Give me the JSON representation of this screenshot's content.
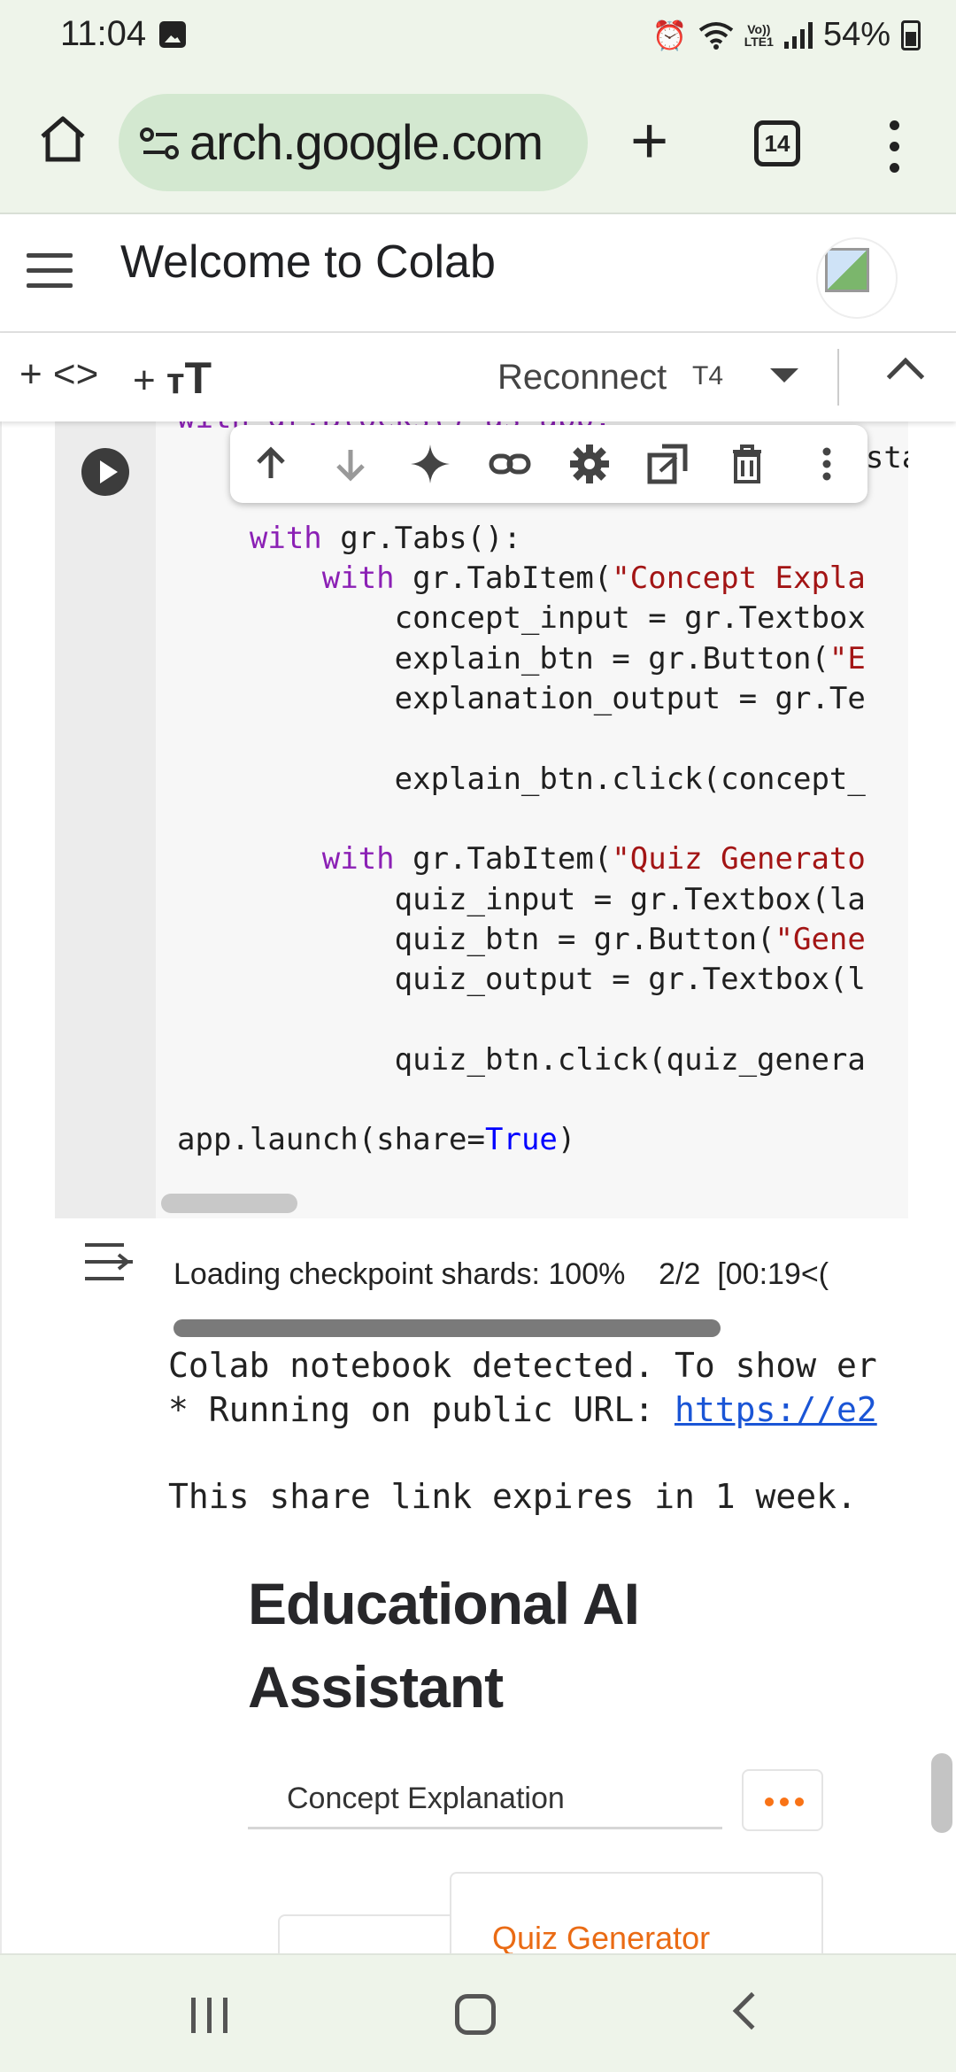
{
  "status_bar": {
    "time": "11:04",
    "battery": "54%",
    "network": "LTE1",
    "icons": [
      "photo-icon",
      "alarm-icon",
      "wifi-icon",
      "volte-icon",
      "signal-icon",
      "battery-icon"
    ]
  },
  "browser": {
    "url": "arch.google.com",
    "tab_count": "14"
  },
  "colab": {
    "title": "Welcome to Colab",
    "toolbar": {
      "add_code": "+ <>",
      "add_text": "+",
      "reconnect": "Reconnect",
      "runtime": "T4"
    }
  },
  "code_lines": [
    {
      "indent": "",
      "parts": [
        {
          "t": "with gr.Blocks() as app:",
          "c": "kw-partial"
        }
      ]
    },
    {
      "indent": "    ",
      "parts": [
        {
          "t": "gr.Markdown(\"# Educational AI Assistant\")",
          "c": ""
        }
      ]
    },
    {
      "indent": "",
      "parts": []
    },
    {
      "indent": "    ",
      "parts": [
        {
          "t": "with",
          "c": "kw"
        },
        {
          "t": " gr.Tabs():",
          "c": ""
        }
      ]
    },
    {
      "indent": "        ",
      "parts": [
        {
          "t": "with",
          "c": "kw"
        },
        {
          "t": " gr.TabItem(",
          "c": ""
        },
        {
          "t": "\"Concept Expla",
          "c": "str"
        }
      ]
    },
    {
      "indent": "            ",
      "parts": [
        {
          "t": "concept_input = gr.Textbox",
          "c": ""
        }
      ]
    },
    {
      "indent": "            ",
      "parts": [
        {
          "t": "explain_btn = gr.Button(",
          "c": ""
        },
        {
          "t": "\"E",
          "c": "str"
        }
      ]
    },
    {
      "indent": "            ",
      "parts": [
        {
          "t": "explanation_output = gr.Te",
          "c": ""
        }
      ]
    },
    {
      "indent": "",
      "parts": []
    },
    {
      "indent": "            ",
      "parts": [
        {
          "t": "explain_btn.click(concept_",
          "c": ""
        }
      ]
    },
    {
      "indent": "",
      "parts": []
    },
    {
      "indent": "        ",
      "parts": [
        {
          "t": "with",
          "c": "kw"
        },
        {
          "t": " gr.TabItem(",
          "c": ""
        },
        {
          "t": "\"Quiz Generato",
          "c": "str"
        }
      ]
    },
    {
      "indent": "            ",
      "parts": [
        {
          "t": "quiz_input = gr.Textbox(la",
          "c": ""
        }
      ]
    },
    {
      "indent": "            ",
      "parts": [
        {
          "t": "quiz_btn = gr.Button(",
          "c": ""
        },
        {
          "t": "\"Gene",
          "c": "str"
        }
      ]
    },
    {
      "indent": "            ",
      "parts": [
        {
          "t": "quiz_output = gr.Textbox(l",
          "c": ""
        }
      ]
    },
    {
      "indent": "",
      "parts": []
    },
    {
      "indent": "            ",
      "parts": [
        {
          "t": "quiz_btn.click(quiz_genera",
          "c": ""
        }
      ]
    },
    {
      "indent": "",
      "parts": []
    },
    {
      "indent": "",
      "parts": [
        {
          "t": "app.launch(share=",
          "c": ""
        },
        {
          "t": "True",
          "c": "bool"
        },
        {
          "t": ")",
          "c": ""
        }
      ]
    }
  ],
  "cell_actions": [
    "move-up-icon",
    "move-down-icon",
    "gemini-icon",
    "link-icon",
    "settings-icon",
    "mirror-cell-icon",
    "delete-icon",
    "more-vert-icon"
  ],
  "output": {
    "progress_label": "Loading checkpoint shards: 100%",
    "progress_count": "2/2  [00:19<(",
    "progress_fraction": 1.0,
    "line1": "Colab notebook detected. To show er",
    "line2_prefix": "* Running on public URL: ",
    "line2_link": "https://e2",
    "line3": "This share link expires in 1 week.",
    "gradio_title_1": "Educational AI",
    "gradio_title_2": "Assistant",
    "tab_concept": "Concept Explanation",
    "tab_quiz": "Quiz Generator"
  }
}
